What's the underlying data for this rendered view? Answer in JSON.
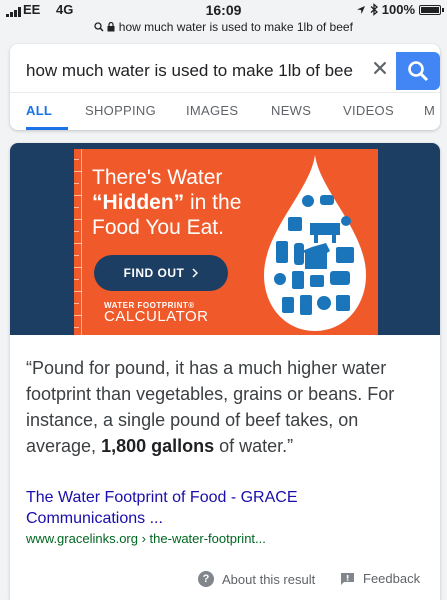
{
  "status_bar": {
    "carrier": "EE",
    "network": "4G",
    "time": "16:09",
    "battery": "100%",
    "url": "how much water is used to make 1lb of beef"
  },
  "search": {
    "query": "how much water is used to make 1lb of bee",
    "clear_icon": "close-icon",
    "search_icon": "search-icon"
  },
  "tabs": [
    "ALL",
    "SHOPPING",
    "IMAGES",
    "NEWS",
    "VIDEOS",
    "M"
  ],
  "result": {
    "image": {
      "headline_1": "There's Water",
      "headline_hidden": "“Hidden”",
      "headline_2": " in the",
      "headline_3": "Food You Eat.",
      "button": "FIND OUT",
      "logo_line1": "WATER FOOTPRINT®",
      "logo_line2": "CALCULATOR"
    },
    "quote_start": "“Pound for pound, it has a much higher water footprint than vegetables, grains or beans. For instance, a single pound of beef takes, on average, ",
    "quote_bold": "1,800 gallons",
    "quote_end": " of water.”",
    "title_line1": "The Water Footprint of Food - GRACE",
    "title_line2": "Communications ...",
    "url": "www.gracelinks.org › the-water-footprint...",
    "about_label": "About this result",
    "feedback_label": "Feedback"
  },
  "colors": {
    "accent_blue": "#4285f4",
    "link_blue": "#1a0dab",
    "url_green": "#006621",
    "banner_orange": "#f05a2a",
    "banner_navy": "#1d3e63"
  }
}
